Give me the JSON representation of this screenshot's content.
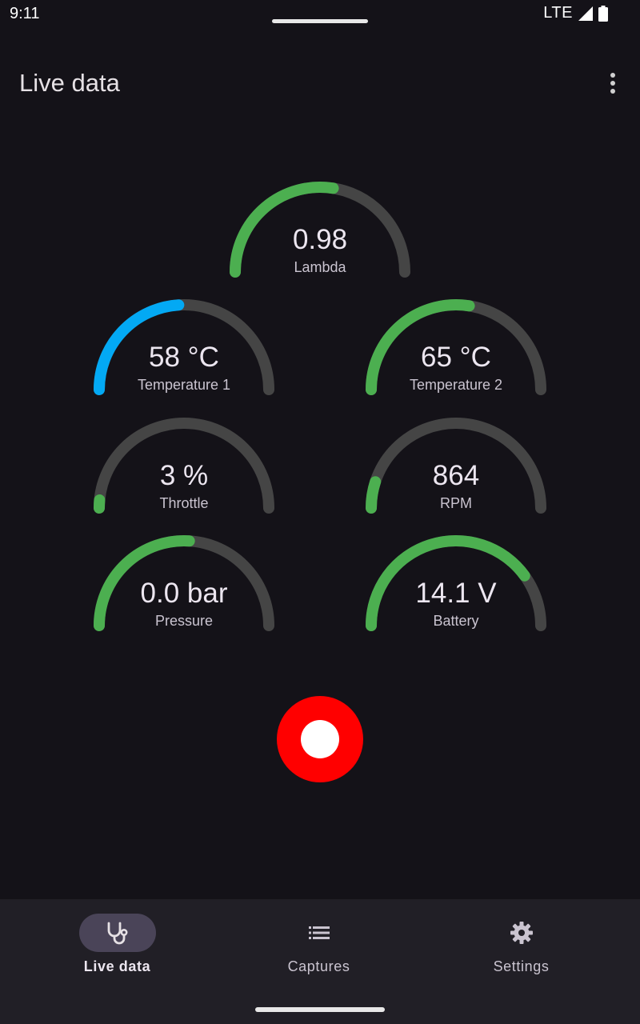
{
  "status": {
    "time": "9:11",
    "network": "LTE",
    "signal_icon": "signal-icon",
    "battery_icon": "battery-icon"
  },
  "app_bar": {
    "title": "Live data",
    "overflow_icon": "more-vert-icon"
  },
  "colors": {
    "track": "#454545",
    "green": "#4caf50",
    "blue": "#03a9f4",
    "record": "#ff0000",
    "background": "#141218",
    "nav_background": "#211f26",
    "nav_indicator": "#4a4458"
  },
  "gauges": [
    {
      "id": "lambda",
      "value": "0.98",
      "label": "Lambda",
      "fraction": 0.55,
      "color": "#4caf50"
    },
    {
      "id": "temperature-1",
      "value": "58 °C",
      "label": "Temperature 1",
      "fraction": 0.48,
      "color": "#03a9f4"
    },
    {
      "id": "temperature-2",
      "value": "65 °C",
      "label": "Temperature 2",
      "fraction": 0.55,
      "color": "#4caf50"
    },
    {
      "id": "throttle",
      "value": "3 %",
      "label": "Throttle",
      "fraction": 0.03,
      "color": "#4caf50"
    },
    {
      "id": "rpm",
      "value": "864",
      "label": "RPM",
      "fraction": 0.1,
      "color": "#4caf50"
    },
    {
      "id": "pressure",
      "value": "0.0 bar",
      "label": "Pressure",
      "fraction": 0.52,
      "color": "#4caf50"
    },
    {
      "id": "battery",
      "value": "14.1 V",
      "label": "Battery",
      "fraction": 0.8,
      "color": "#4caf50"
    }
  ],
  "record_button": {
    "icon": "record-icon"
  },
  "nav": [
    {
      "label": "Live data",
      "icon": "stethoscope-icon",
      "active": true
    },
    {
      "label": "Captures",
      "icon": "list-icon",
      "active": false
    },
    {
      "label": "Settings",
      "icon": "gear-icon",
      "active": false
    }
  ]
}
